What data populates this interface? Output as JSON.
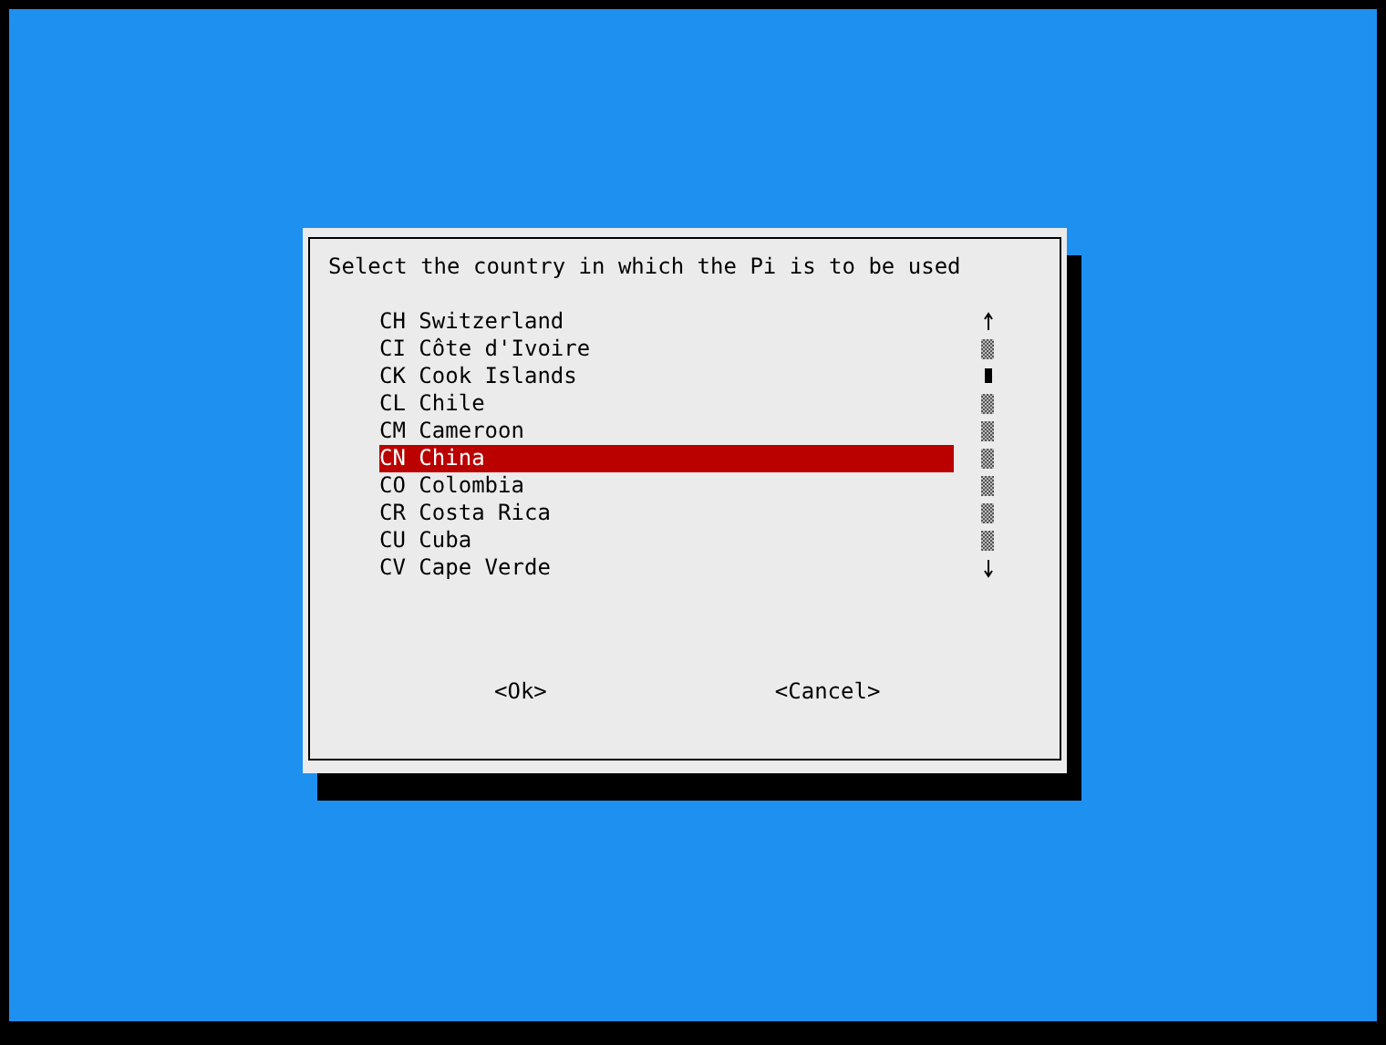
{
  "dialog": {
    "prompt": "Select the country in which the Pi is to be used",
    "items": [
      {
        "label": "CH Switzerland",
        "selected": false
      },
      {
        "label": "CI Côte d'Ivoire",
        "selected": false
      },
      {
        "label": "CK Cook Islands",
        "selected": false
      },
      {
        "label": "CL Chile",
        "selected": false
      },
      {
        "label": "CM Cameroon",
        "selected": false
      },
      {
        "label": "CN China",
        "selected": true
      },
      {
        "label": "CO Colombia",
        "selected": false
      },
      {
        "label": "CR Costa Rica",
        "selected": false
      },
      {
        "label": "CU Cuba",
        "selected": false
      },
      {
        "label": "CV Cape Verde",
        "selected": false
      }
    ],
    "buttons": [
      "<Ok>",
      "<Cancel>"
    ]
  }
}
